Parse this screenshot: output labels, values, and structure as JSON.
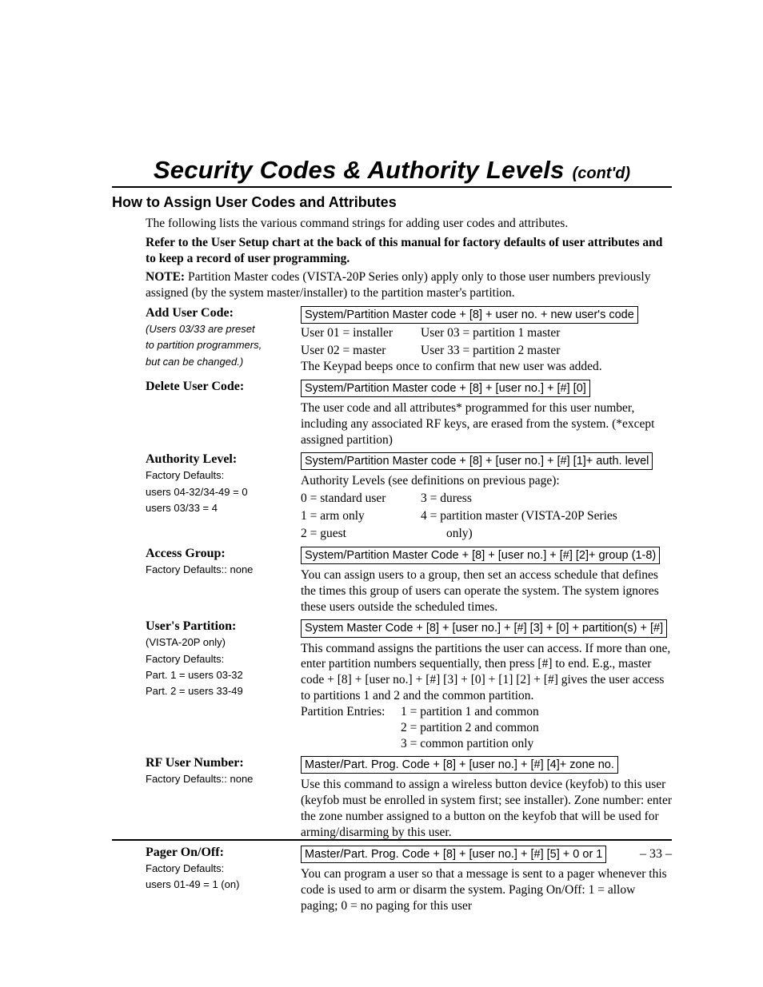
{
  "title": {
    "main": "Security Codes & Authority Levels",
    "cont": "(cont'd)"
  },
  "section_heading": "How to Assign User Codes and Attributes",
  "intro": {
    "p1": "The following lists the various command strings for adding user codes and attributes.",
    "p2": "Refer to the User Setup chart at the back of this manual for factory defaults of user attributes and to keep a record of user programming.",
    "note_label": "NOTE:",
    "note_text": " Partition Master codes (VISTA-20P Series only) apply only to those user numbers previously assigned (by the system master/installer) to the partition master's partition."
  },
  "rows": {
    "add_user": {
      "label": "Add User Code:",
      "left_note1": "(Users 03/33 are preset",
      "left_note2": "to partition programmers,",
      "left_note3": "but can be changed.)",
      "cmd": "System/Partition Master code + [8] + user no. + new user's code",
      "u01": "User 01 = installer",
      "u02": "User 02 = master",
      "u03": "User 03 = partition 1 master",
      "u33": "User 33 = partition 2 master",
      "beep": "The Keypad beeps once to confirm that new user was added."
    },
    "delete": {
      "label": "Delete User Code:",
      "cmd": "System/Partition Master code + [8] + [user no.] + [#] [0]",
      "desc": "The user code and all attributes* programmed for this user number, including any associated RF keys, are erased from the system. (*except assigned partition)"
    },
    "auth": {
      "label": "Authority Level:",
      "left_note1": "Factory Defaults:",
      "left_note2": "users 04-32/34-49 = 0",
      "left_note3": "users 03/33 = 4",
      "cmd": "System/Partition Master code + [8] + [user no.] + [#] [1]+ auth. level",
      "intro": "Authority Levels (see definitions on previous page):",
      "l0": "0 = standard user",
      "l1": "1 = arm only",
      "l2": "2 = guest",
      "l3": "3 = duress",
      "l4a": "4 = partition master (VISTA-20P Series",
      "l4b": "only)"
    },
    "access": {
      "label": "Access Group:",
      "left_note1": "Factory Defaults:: none",
      "cmd": "System/Partition Master Code + [8] + [user no.] + [#] [2]+ group (1-8)",
      "desc": "You can assign users to a group, then set an access schedule that defines the times this group of users can operate the system. The system ignores these users outside the scheduled times."
    },
    "partition": {
      "label": "User's Partition:",
      "left_note1": "(VISTA-20P only)",
      "left_note2": "Factory Defaults:",
      "left_note3": "Part. 1 = users 03-32",
      "left_note4": "Part. 2 = users 33-49",
      "cmd": "System Master Code + [8] + [user no.] + [#] [3] + [0] + partition(s) + [#]",
      "desc1": "This command assigns the partitions the user can access. If more than one, enter partition numbers sequentially, then press [#] to end. E.g., master code + [8] + [user no.] + [#] [3] + [0] + [1] [2] + [#] gives the user access to partitions 1 and 2 and the common partition.",
      "pe_label": "Partition Entries:",
      "pe1": "1 = partition 1 and common",
      "pe2": "2 = partition 2 and common",
      "pe3": "3 = common partition only"
    },
    "rf": {
      "label": "RF User Number:",
      "left_note1": "Factory Defaults:: none",
      "cmd": "Master/Part. Prog. Code +  [8] + [user no.]  + [#] [4]+ zone no.",
      "desc": "Use this command to assign a wireless button device (keyfob) to this user (keyfob must be enrolled in system first; see installer). Zone number:  enter the zone number assigned to a button on the keyfob that will be used for arming/disarming by this user."
    },
    "pager": {
      "label": "Pager On/Off:",
      "left_note1": "Factory Defaults:",
      "left_note2": "users 01-49 = 1 (on)",
      "cmd": "Master/Part. Prog. Code +  [8] + [user no.]  + [#] [5] + 0 or 1",
      "desc": "You can program a user so that a message is sent to a pager whenever this code is used to arm or disarm the system. Paging On/Off: 1 = allow paging; 0 = no paging for this user"
    }
  },
  "page_num": "– 33 –"
}
